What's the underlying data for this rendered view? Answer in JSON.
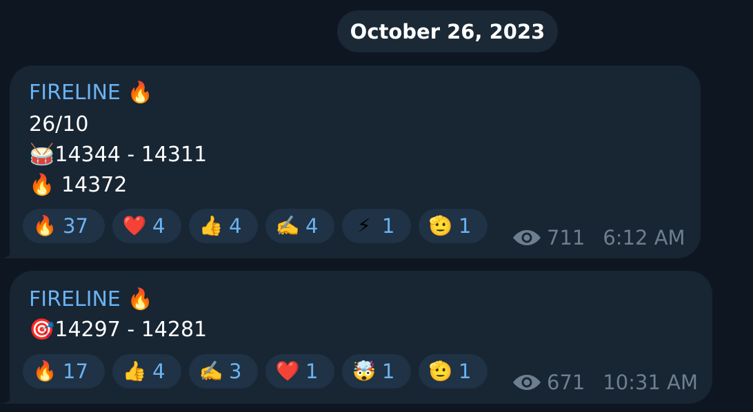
{
  "date_header": "October 26, 2023",
  "messages": [
    {
      "sender": "FIRELINE",
      "sender_emoji": "🔥",
      "lines": [
        {
          "emoji": "",
          "text": "26/10"
        },
        {
          "emoji": "🥁",
          "text": "14344 - 14311"
        },
        {
          "emoji": "🔥",
          "text": " 14372"
        }
      ],
      "reactions": [
        {
          "emoji": "🔥",
          "count": "37"
        },
        {
          "emoji": "❤️",
          "count": "4"
        },
        {
          "emoji": "👍",
          "count": "4"
        },
        {
          "emoji": "✍️",
          "count": "4"
        },
        {
          "emoji": "⚡",
          "count": "1"
        },
        {
          "emoji": "🫡",
          "count": "1"
        }
      ],
      "views": "711",
      "time": "6:12 AM",
      "icons": {
        "views": "eye-icon"
      }
    },
    {
      "sender": "FIRELINE",
      "sender_emoji": "🔥",
      "lines": [
        {
          "emoji": "🎯",
          "text": "14297 - 14281"
        }
      ],
      "reactions": [
        {
          "emoji": "🔥",
          "count": "17"
        },
        {
          "emoji": "👍",
          "count": "4"
        },
        {
          "emoji": "✍️",
          "count": "3"
        },
        {
          "emoji": "❤️",
          "count": "1"
        },
        {
          "emoji": "🤯",
          "count": "1"
        },
        {
          "emoji": "🫡",
          "count": "1"
        }
      ],
      "views": "671",
      "time": "10:31 AM",
      "icons": {
        "views": "eye-icon"
      }
    }
  ],
  "colors": {
    "background": "#0e1621",
    "bubble": "#182533",
    "date_pill": "#1b2836",
    "reaction_pill": "#203245",
    "accent": "#6ab3f3",
    "meta": "#6d7f8f",
    "text": "#ffffff"
  }
}
